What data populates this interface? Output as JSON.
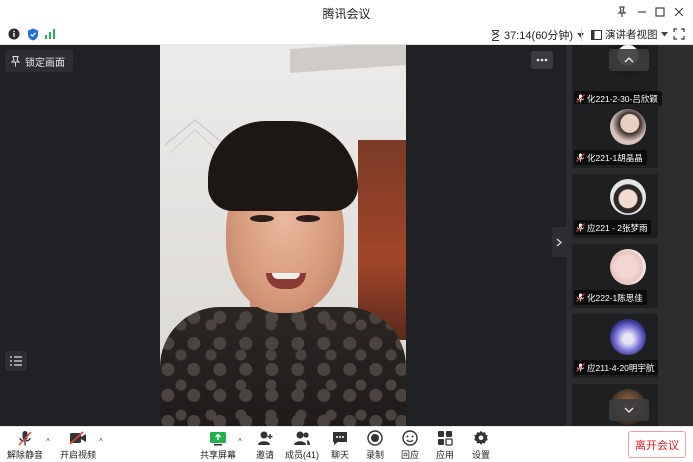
{
  "window": {
    "title": "腾讯会议"
  },
  "infobar": {
    "timer": "37:14(60分钟)",
    "view_mode": "演讲者视图"
  },
  "main": {
    "lock_label": "锁定画面"
  },
  "participants": [
    {
      "name": "化221-2-30-吕欣颖"
    },
    {
      "name": "化221-1胡晶晶"
    },
    {
      "name": "应221 - 2张梦雨"
    },
    {
      "name": "化222-1陈思佳"
    },
    {
      "name": "应211-4-20明宇航"
    }
  ],
  "toolbar": {
    "unmute": "解除静音",
    "start_video": "开启视频",
    "share_screen": "共享屏幕",
    "invite": "邀请",
    "members": "成员(41)",
    "chat": "聊天",
    "record": "录制",
    "replay": "回应",
    "apps": "应用",
    "settings": "设置",
    "leave": "离开会议"
  },
  "colors": {
    "accent_green": "#22b14c",
    "shield_blue": "#1e6fe0",
    "leave_red": "#e02020",
    "mute_red": "#e0463c"
  }
}
